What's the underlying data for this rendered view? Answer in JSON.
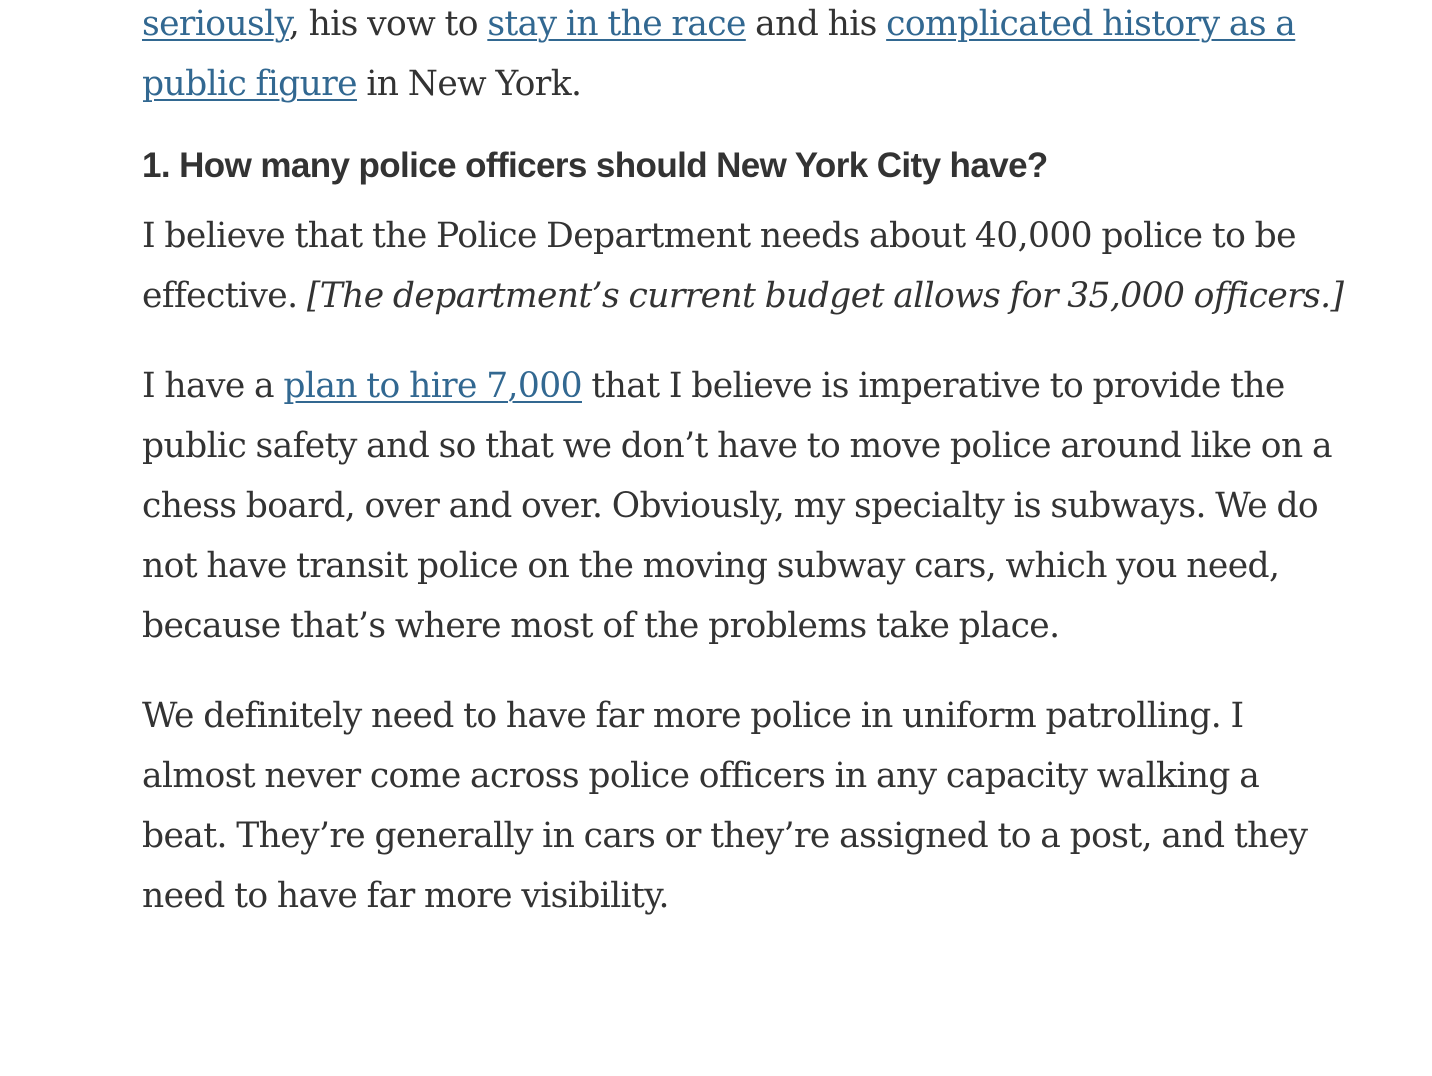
{
  "intro": {
    "link_seriously": "seriously",
    "text_1": ", his vow to ",
    "link_stay": "stay in the race",
    "text_2": " and his ",
    "link_history": "complicated history as a public figure",
    "text_3": " in New York."
  },
  "question": {
    "heading": "1. How many police officers should New York City have?"
  },
  "answer_p1": {
    "text": "I believe that the Police Department needs about 40,000 police to be effective. ",
    "italic_note": "[The department’s current budget allows for 35,000 officers.]"
  },
  "answer_p2": {
    "text_before": "I have a ",
    "link_plan": "plan to hire 7,000",
    "text_after": " that I believe is imperative to provide the public safety and so that we don’t have to move police around like on a chess board, over and over. Obviously, my specialty is subways. We do not have transit police on the moving subway cars, which you need, because that’s where most of the problems take place."
  },
  "answer_p3": {
    "text": "We definitely need to have far more police in uniform patrolling. I almost never come across police officers in any capacity walking a beat. They’re generally in cars or they’re assigned to a post, and they need to have far more visibility."
  },
  "colors": {
    "body_text": "#333333",
    "link": "#326891",
    "background": "#ffffff"
  }
}
